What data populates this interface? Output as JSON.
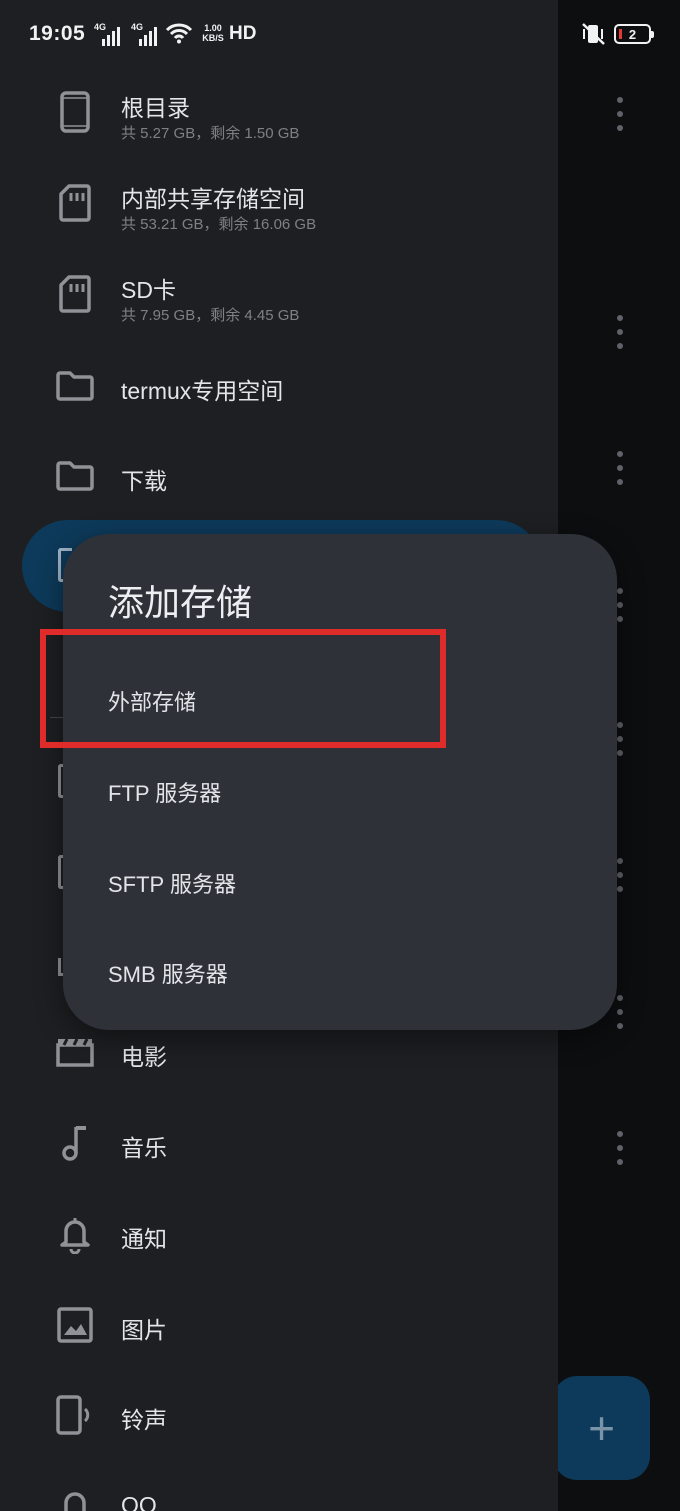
{
  "status_bar": {
    "time": "19:05",
    "signal_1_label": "4G",
    "signal_2_label": "4G",
    "net_speed_value": "1.00",
    "net_speed_unit": "KB/S",
    "hd_label": "HD",
    "battery_level": "2"
  },
  "drawer": {
    "storage_items": [
      {
        "title": "根目录",
        "subtitle": "共 5.27 GB，剩余 1.50 GB",
        "icon": "phone-icon"
      },
      {
        "title": "内部共享存储空间",
        "subtitle": "共 53.21 GB，剩余 16.06 GB",
        "icon": "sd-card-icon"
      },
      {
        "title": "SD卡",
        "subtitle": "共 7.95 GB，剩余 4.45 GB",
        "icon": "sd-card-icon"
      }
    ],
    "folder_items": [
      {
        "title": "termux专用空间",
        "icon": "folder-icon"
      },
      {
        "title": "下载",
        "icon": "folder-icon"
      }
    ],
    "media_items": [
      {
        "title": "电影",
        "icon": "movie-icon"
      },
      {
        "title": "音乐",
        "icon": "music-icon"
      },
      {
        "title": "通知",
        "icon": "bell-icon"
      },
      {
        "title": "图片",
        "icon": "image-icon"
      },
      {
        "title": "铃声",
        "icon": "ringtone-icon"
      },
      {
        "title": "QQ",
        "icon": "qq-icon"
      }
    ]
  },
  "dialog": {
    "title": "添加存储",
    "options": [
      "外部存储",
      "FTP 服务器",
      "SFTP 服务器",
      "SMB 服务器"
    ]
  },
  "colors": {
    "drawer_bg": "#1e1f22",
    "dialog_bg": "#2e3138",
    "selected_pill": "#0d3a5a",
    "highlight_border": "#e02b2b",
    "battery_low": "#e53935"
  }
}
